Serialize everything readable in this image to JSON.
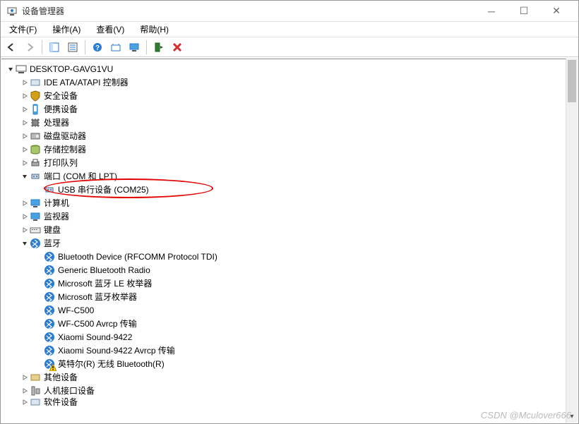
{
  "title": "设备管理器",
  "menu": {
    "file": "文件(F)",
    "action": "操作(A)",
    "view": "查看(V)",
    "help": "帮助(H)"
  },
  "watermark": "CSDN @Mculover666",
  "tree": {
    "root": "DESKTOP-GAVG1VU",
    "items": [
      {
        "label": "IDE ATA/ATAPI 控制器",
        "expanded": false
      },
      {
        "label": "安全设备",
        "expanded": false
      },
      {
        "label": "便携设备",
        "expanded": false
      },
      {
        "label": "处理器",
        "expanded": false
      },
      {
        "label": "磁盘驱动器",
        "expanded": false
      },
      {
        "label": "存储控制器",
        "expanded": false
      },
      {
        "label": "打印队列",
        "expanded": false
      },
      {
        "label": "端口 (COM 和 LPT)",
        "expanded": true,
        "children": [
          {
            "label": "USB 串行设备 (COM25)",
            "circled": true
          }
        ]
      },
      {
        "label": "计算机",
        "expanded": false
      },
      {
        "label": "监视器",
        "expanded": false
      },
      {
        "label": "键盘",
        "expanded": false
      },
      {
        "label": "蓝牙",
        "expanded": true,
        "children": [
          {
            "label": "Bluetooth Device (RFCOMM Protocol TDI)"
          },
          {
            "label": "Generic Bluetooth Radio"
          },
          {
            "label": "Microsoft 蓝牙 LE 枚举器"
          },
          {
            "label": "Microsoft 蓝牙枚举器"
          },
          {
            "label": "WF-C500"
          },
          {
            "label": "WF-C500 Avrcp 传输"
          },
          {
            "label": "Xiaomi Sound-9422"
          },
          {
            "label": "Xiaomi Sound-9422 Avrcp 传输"
          },
          {
            "label": "英特尔(R) 无线 Bluetooth(R)",
            "warn": true
          }
        ]
      },
      {
        "label": "其他设备",
        "expanded": false
      },
      {
        "label": "人机接口设备",
        "expanded": false
      },
      {
        "label": "软件设备",
        "expanded": false,
        "cut": true
      }
    ]
  }
}
